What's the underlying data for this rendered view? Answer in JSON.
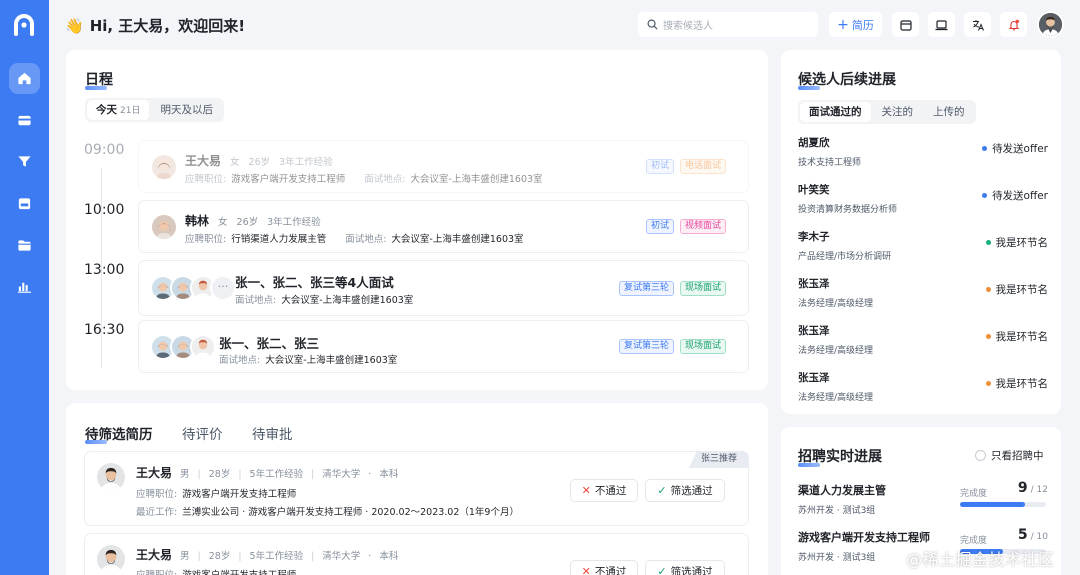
{
  "greeting": {
    "emoji": "👋",
    "text": "Hi, 王大易，欢迎回来!"
  },
  "search": {
    "placeholder": "搜索候选人"
  },
  "new_resume_label": "简历",
  "colors": {
    "accent": "#3d7bf2",
    "sidebar": "#3d7bf2",
    "background": "#f3f5f9"
  },
  "sidebar": {
    "items": [
      {
        "icon": "home-icon",
        "active": true
      },
      {
        "icon": "card-icon"
      },
      {
        "icon": "filter-icon"
      },
      {
        "icon": "calendar-icon"
      },
      {
        "icon": "folder-icon"
      },
      {
        "icon": "chart-icon"
      }
    ]
  },
  "toolbar_icons": [
    "calendar-icon",
    "laptop-icon",
    "translate-icon",
    "bell-icon"
  ],
  "schedule": {
    "title": "日程",
    "tabs": [
      {
        "label": "今天",
        "sub": "21日"
      },
      {
        "label": "明天及以后"
      }
    ],
    "slots": [
      {
        "time": "09:00",
        "name": "王大易",
        "gender": "女",
        "age": "26岁",
        "experience": "3年工作经验",
        "position_label": "应聘职位:",
        "position": "游戏客户端开发支持工程师",
        "location_label": "面试地点:",
        "location": "大会议室-上海丰盛创建1603室",
        "tags": [
          "初试",
          "电话面试"
        ]
      },
      {
        "time": "10:00",
        "name": "韩林",
        "gender": "女",
        "age": "26岁",
        "experience": "3年工作经验",
        "position_label": "应聘职位:",
        "position": "行销渠道人力发展主管",
        "location_label": "面试地点:",
        "location": "大会议室-上海丰盛创建1603室",
        "tags": [
          "初试",
          "视频面试"
        ]
      },
      {
        "time": "13:00",
        "name": "张一、张二、张三等4人面试",
        "more": "···",
        "location_label": "面试地点:",
        "location": "大会议室-上海丰盛创建1603室",
        "tags": [
          "复试第三轮",
          "现场面试"
        ]
      },
      {
        "time": "16:30",
        "name": "张一、张二、张三",
        "location_label": "面试地点:",
        "location": "大会议室-上海丰盛创建1603室",
        "tags": [
          "复试第三轮",
          "现场面试"
        ]
      }
    ]
  },
  "screening": {
    "tabs": [
      "待筛选简历",
      "待评价",
      "待审批"
    ],
    "candidates": [
      {
        "name": "王大易",
        "gender": "男",
        "age": "28岁",
        "experience": "5年工作经验",
        "school": "清华大学",
        "degree": "本科",
        "position_label": "应聘职位:",
        "position": "游戏客户端开发支持工程师",
        "recent_label": "最近工作:",
        "recent": "兰溥实业公司 · 游戏客户端开发支持工程师 · 2020.02～2023.02（1年9个月）",
        "recommend": "张三推荐",
        "reject": "不通过",
        "pass": "筛选通过"
      },
      {
        "name": "王大易",
        "gender": "男",
        "age": "28岁",
        "experience": "5年工作经验",
        "school": "清华大学",
        "degree": "本科",
        "position_label": "应聘职位:",
        "position": "游戏客户端开发支持工程师",
        "reject": "不通过",
        "pass": "筛选通过"
      }
    ]
  },
  "followup": {
    "title": "候选人后续进展",
    "tabs": [
      "面试通过的",
      "关注的",
      "上传的"
    ],
    "items": [
      {
        "name": "胡夏欣",
        "role": "技术支持工程师",
        "status": "待发送offer",
        "color": "#3d7bf2"
      },
      {
        "name": "叶笑笑",
        "role": "投资清算财务数据分析师",
        "status": "待发送offer",
        "color": "#3d7bf2"
      },
      {
        "name": "李木子",
        "role": "产品经理/市场分析调研",
        "status": "我是环节名",
        "color": "#16b07a"
      },
      {
        "name": "张玉泽",
        "role": "法务经理/高级经理",
        "status": "我是环节名",
        "color": "#f08f35"
      },
      {
        "name": "张玉泽",
        "role": "法务经理/高级经理",
        "status": "我是环节名",
        "color": "#f08f35"
      },
      {
        "name": "张玉泽",
        "role": "法务经理/高级经理",
        "status": "我是环节名",
        "color": "#f08f35"
      }
    ]
  },
  "recruit": {
    "title": "招聘实时进展",
    "filter": "只看招聘中",
    "progress_label": "完成度",
    "jobs": [
      {
        "name": "渠道人力发展主管",
        "location": "苏州开发 · 测试3组",
        "done": "9",
        "total": "/ 12",
        "fraction": 0.75
      },
      {
        "name": "游戏客户端开发支持工程师",
        "location": "苏州开发 · 测试3组",
        "done": "5",
        "total": "/ 10",
        "fraction": 0.5
      }
    ]
  },
  "watermark": "@稀土掘金技术社区"
}
